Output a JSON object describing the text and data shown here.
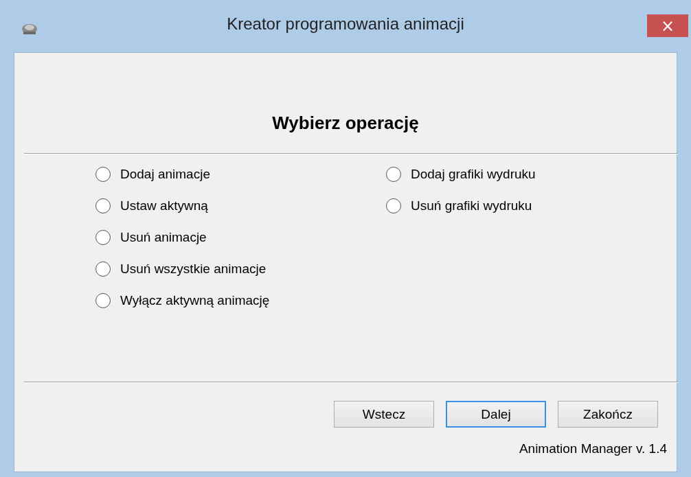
{
  "window": {
    "title": "Kreator programowania animacji",
    "close": "×"
  },
  "heading": "Wybierz operację",
  "options_left": [
    {
      "label": "Dodaj animacje",
      "selected": false
    },
    {
      "label": "Ustaw aktywną",
      "selected": false
    },
    {
      "label": "Usuń animacje",
      "selected": false
    },
    {
      "label": "Usuń wszystkie animacje",
      "selected": false
    },
    {
      "label": "Wyłącz aktywną animację",
      "selected": false
    }
  ],
  "options_right": [
    {
      "label": "Dodaj grafiki wydruku",
      "selected": false
    },
    {
      "label": "Usuń grafiki wydruku",
      "selected": false
    }
  ],
  "buttons": [
    {
      "label": "Wstecz",
      "focused": false
    },
    {
      "label": "Dalej",
      "focused": true
    },
    {
      "label": "Zakończ",
      "focused": false
    }
  ],
  "version": "Animation Manager v. 1.4"
}
